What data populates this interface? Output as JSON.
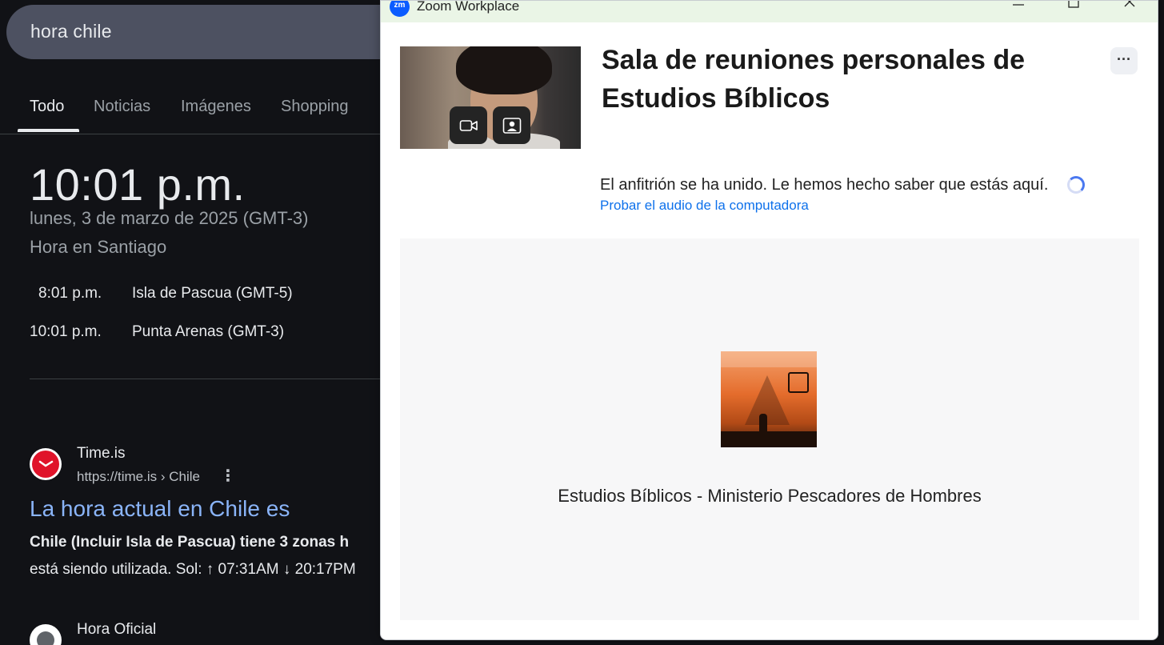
{
  "google": {
    "search_query": "hora chile",
    "tabs": [
      {
        "label": "Todo",
        "active": true
      },
      {
        "label": "Noticias",
        "active": false
      },
      {
        "label": "Imágenes",
        "active": false
      },
      {
        "label": "Shopping",
        "active": false
      }
    ],
    "clock": {
      "time": "10:01 p.m.",
      "date": "lunes, 3 de marzo de 2025 (GMT-3)",
      "place": "Hora en Santiago"
    },
    "zones": [
      {
        "time": "8:01 p.m.",
        "name": "Isla de Pascua (GMT-5)"
      },
      {
        "time": "10:01 p.m.",
        "name": "Punta Arenas (GMT-3)"
      }
    ],
    "results": [
      {
        "site": "Time.is",
        "url": "https://time.is › Chile",
        "title": "La hora actual en Chile es",
        "snippet_line1": "Chile (Incluir Isla de Pascua) tiene 3 zonas h",
        "snippet_line2": "está siendo utilizada. Sol: ↑ 07:31AM ↓ 20:17PM"
      },
      {
        "site": "Hora Oficial"
      }
    ],
    "colors": {
      "background": "#111216",
      "link": "#8ab4f8",
      "searchbox": "#4d5161"
    }
  },
  "zoom": {
    "window_title": "Zoom Workplace",
    "logo_text": "zm",
    "heading": "Sala de reuniones personales de Estudios Bíblicos",
    "more_label": "···",
    "status_text": "El anfitrión se ha unido. Le hemos hecho saber que estás aquí.",
    "audio_link": "Probar el audio de la computadora",
    "meeting_name": "Estudios Bíblicos - Ministerio Pescadores de Hombres",
    "window_buttons": {
      "minimize": "—",
      "maximize": "☐",
      "close": "✕"
    },
    "icons": [
      "video-camera-icon",
      "video-settings-icon",
      "more-icon",
      "loading-spinner-icon"
    ],
    "colors": {
      "brand": "#0b5cff",
      "link": "#0e71eb",
      "titlebar": "#eaf5e6"
    }
  }
}
